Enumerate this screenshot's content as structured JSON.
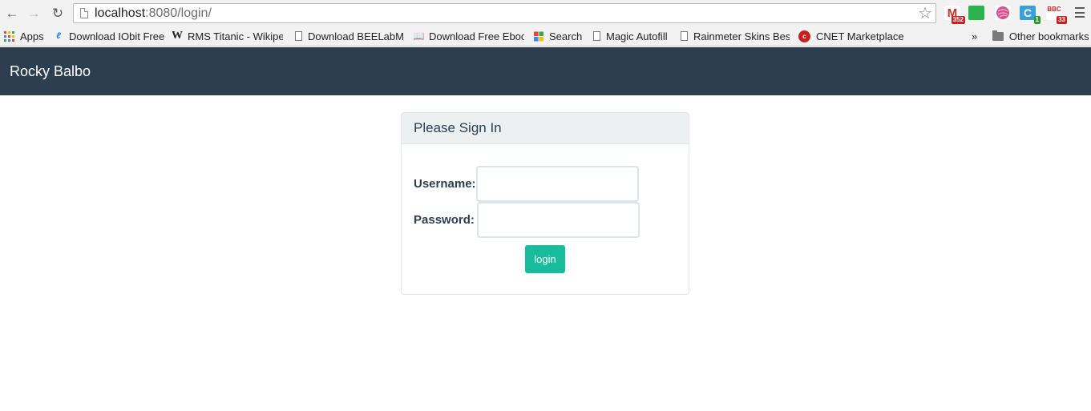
{
  "browser": {
    "url_host": "localhost",
    "url_path": ":8080/login/",
    "extensions": [
      {
        "name": "gmail-extension-icon",
        "label": "M",
        "badge": "352",
        "color": "#c4302b"
      },
      {
        "name": "feedly-extension-icon",
        "label": "",
        "badge": "",
        "color": "#2bb24c"
      },
      {
        "name": "yarn-extension-icon",
        "label": "",
        "badge": "",
        "color": "#d64f8a"
      },
      {
        "name": "c-extension-icon",
        "label": "C",
        "badge": "1",
        "color": "#3aa0d8"
      },
      {
        "name": "bbc-extension-icon",
        "label": "BBC",
        "badge": "33",
        "color": "#ffffff"
      }
    ]
  },
  "bookmarks": {
    "apps": "Apps",
    "items": [
      "Download IObit Freev",
      "RMS Titanic - Wikiped",
      "Download BEELabMa",
      "Download Free Ebook",
      "Search",
      "Magic Autofill",
      "Rainmeter Skins Best",
      "CNET Marketplace |"
    ],
    "overflow": "»",
    "other": "Other bookmarks"
  },
  "navbar": {
    "brand": "Rocky Balbo"
  },
  "login": {
    "heading": "Please Sign In",
    "username_label": "Username:",
    "username_value": "",
    "password_label": "Password:",
    "password_value": "",
    "button_label": "login"
  },
  "colors": {
    "navbar_bg": "#2c3e50",
    "button_bg": "#18bc9c",
    "panel_heading_bg": "#ecf0f1"
  }
}
